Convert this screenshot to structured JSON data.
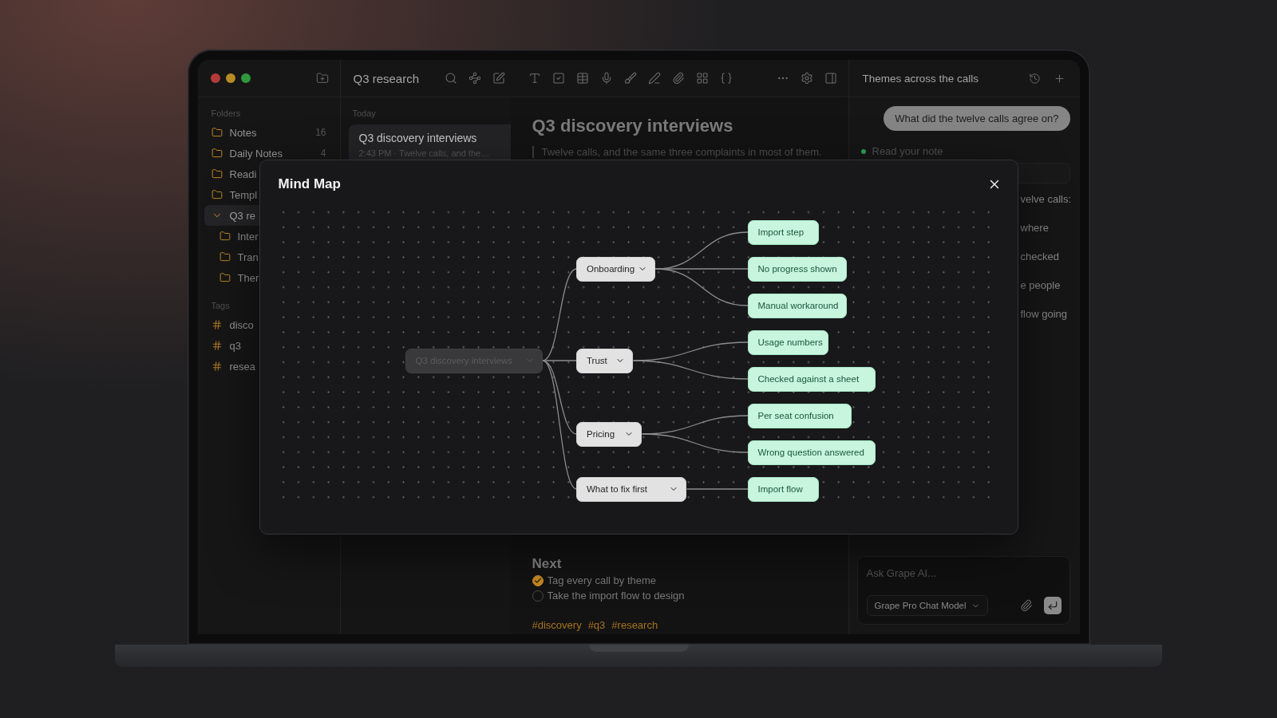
{
  "sidebar": {
    "folders_label": "Folders",
    "folders": [
      {
        "label": "Notes",
        "count": "16",
        "selected": false
      },
      {
        "label": "Daily Notes",
        "count": "4",
        "selected": false
      },
      {
        "label": "Readi",
        "selected": false
      },
      {
        "label": "Templ",
        "selected": false
      },
      {
        "label": "Q3 re",
        "selected": true,
        "expanded": true,
        "children": [
          {
            "label": "Inter",
            "selected": false
          },
          {
            "label": "Tran",
            "selected": false
          },
          {
            "label": "Ther",
            "selected": false
          }
        ]
      }
    ],
    "tags_label": "Tags",
    "tags": [
      {
        "label": "disco",
        "selected": false
      },
      {
        "label": "q3",
        "selected": false
      },
      {
        "label": "resea",
        "selected": false
      }
    ]
  },
  "toolbar": {
    "title": "Q3 research"
  },
  "note_list": {
    "section": "Today",
    "notes": [
      {
        "title": "Q3 discovery interviews",
        "preview": "2:43 PM · Twelve calls, and the…",
        "selected": true
      }
    ]
  },
  "editor": {
    "title": "Q3 discovery interviews",
    "quote": "Twelve calls, and the same three complaints in most of them.",
    "section": "Next",
    "tasks": [
      {
        "text": "Tag every call by theme",
        "checked": true
      },
      {
        "text": "Take the import flow to design",
        "checked": false
      }
    ],
    "tags": [
      "#discovery",
      "#q3",
      "#research"
    ]
  },
  "assistant": {
    "title": "Themes across the calls",
    "question": "What did the twelve calls agree on?",
    "status": "Read your note",
    "answer_fragments": [
      "velve calls:",
      "where",
      "checked",
      "e people",
      "flow going"
    ],
    "input": {
      "placeholder": "Ask Grape AI..."
    },
    "model": "Grape Pro Chat Model"
  },
  "mind_map": {
    "title": "Mind Map",
    "root": {
      "label": "Q3 discovery interviews",
      "expanded": true,
      "children": [
        {
          "label": "Onboarding",
          "expanded": true,
          "children": [
            {
              "label": "Import step"
            },
            {
              "label": "No progress shown"
            },
            {
              "label": "Manual workaround"
            }
          ]
        },
        {
          "label": "Trust",
          "expanded": true,
          "children": [
            {
              "label": "Usage numbers"
            },
            {
              "label": "Checked against a sheet"
            }
          ]
        },
        {
          "label": "Pricing",
          "expanded": true,
          "children": [
            {
              "label": "Per seat confusion"
            },
            {
              "label": "Wrong question answered"
            }
          ]
        },
        {
          "label": "What to fix first",
          "expanded": true,
          "children": [
            {
              "label": "Import flow"
            }
          ]
        }
      ]
    }
  }
}
